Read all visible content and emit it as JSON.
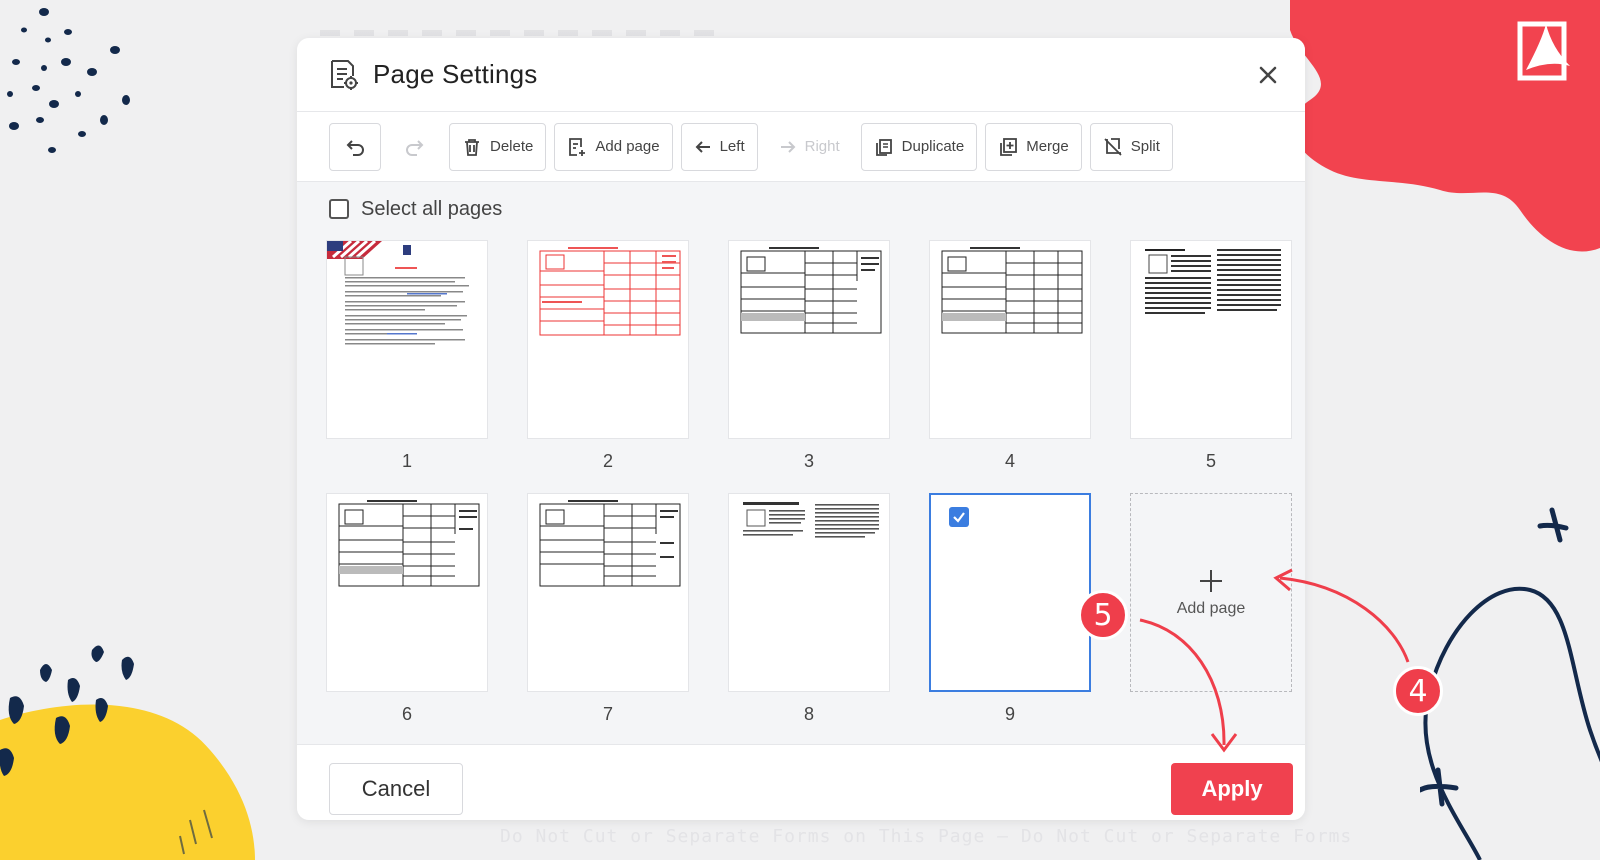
{
  "modal": {
    "title": "Page Settings",
    "toolbar": {
      "delete": "Delete",
      "add_page": "Add page",
      "left": "Left",
      "right": "Right",
      "duplicate": "Duplicate",
      "merge": "Merge",
      "split": "Split"
    },
    "select_all": "Select all pages",
    "pages": [
      "1",
      "2",
      "3",
      "4",
      "5",
      "6",
      "7",
      "8",
      "9"
    ],
    "add_tile_label": "Add page",
    "cancel": "Cancel",
    "apply": "Apply"
  },
  "steps": {
    "step_4": "4",
    "step_5": "5"
  },
  "background_text": "Do Not Cut or Separate Forms on This Page — Do Not Cut or Separate Forms",
  "colors": {
    "accent_red": "#f0414f",
    "selection_blue": "#3b7de0",
    "deco_yellow": "#fbd02e",
    "deco_navy": "#13294b"
  }
}
